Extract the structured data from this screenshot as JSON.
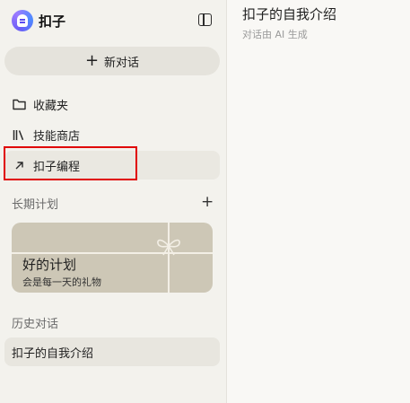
{
  "brand": {
    "name": "扣子",
    "logo_icon": "coze-logo-icon"
  },
  "sidebar": {
    "collapse_icon": "sidebar-toggle-icon",
    "new_chat_label": "新对话",
    "nav": [
      {
        "label": "收藏夹",
        "icon": "folder-icon"
      },
      {
        "label": "技能商店",
        "icon": "library-icon"
      },
      {
        "label": "扣子编程",
        "icon": "external-arrow-icon"
      }
    ],
    "plans": {
      "header": "长期计划",
      "card_title": "好的计划",
      "card_subtitle": "会是每一天的礼物"
    },
    "history": {
      "header": "历史对话",
      "items": [
        "扣子的自我介绍"
      ]
    }
  },
  "main": {
    "title": "扣子的自我介绍",
    "subtitle": "对话由 AI 生成"
  },
  "colors": {
    "highlight": "#e00000",
    "card": "#cdc7b6"
  }
}
